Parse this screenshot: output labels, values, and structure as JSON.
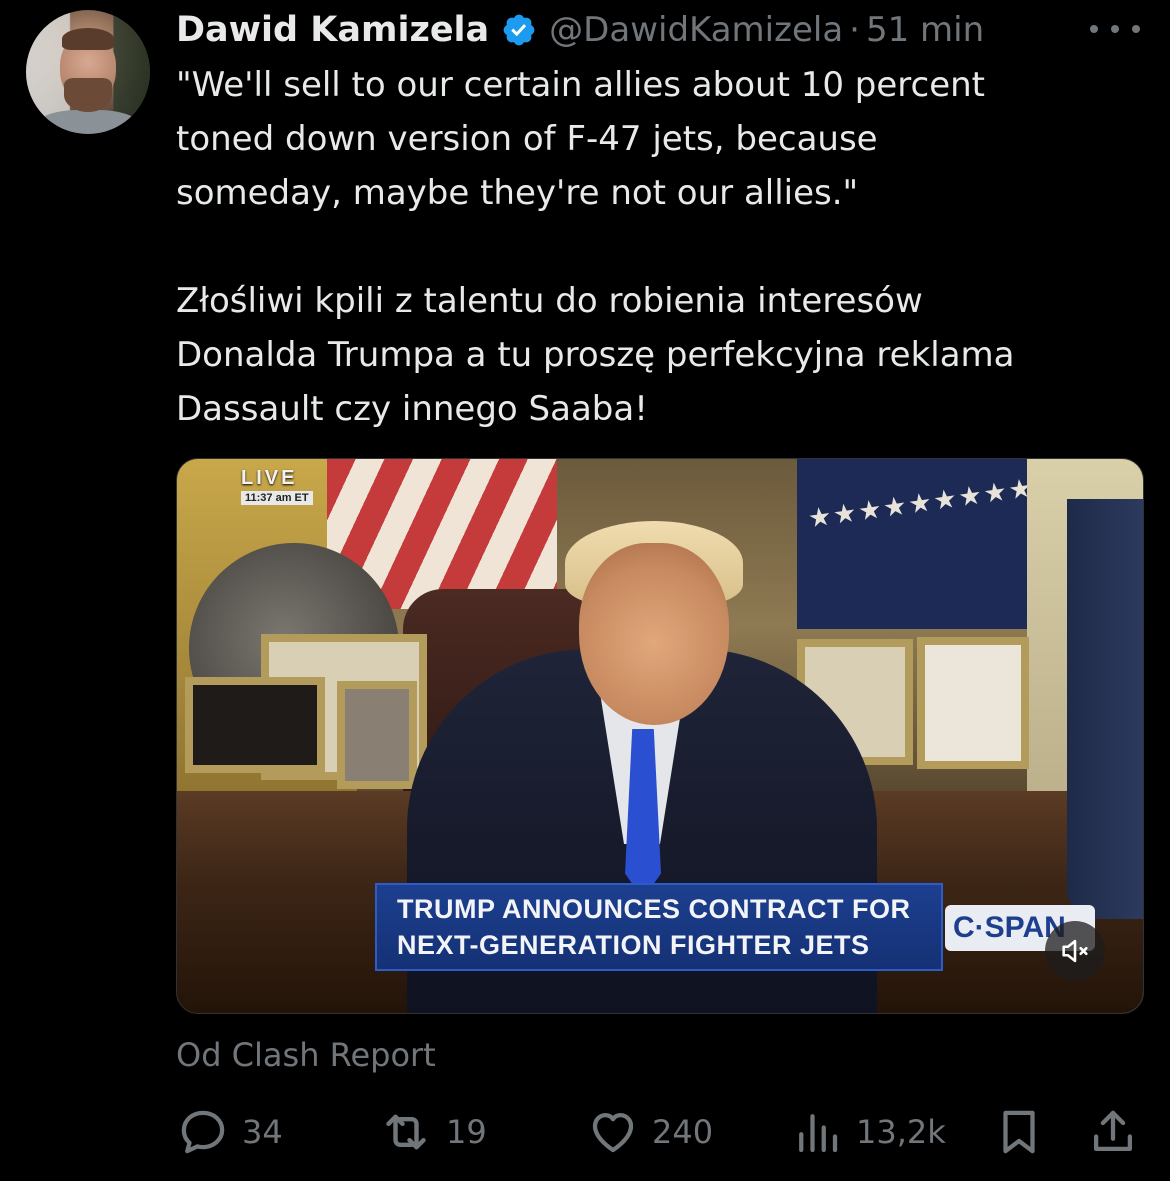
{
  "author": {
    "name": "Dawid Kamizela",
    "handle": "@DawidKamizela",
    "separator": "·",
    "time": "51 min"
  },
  "tweet": {
    "paragraph1": [
      "\"We'll sell to our certain allies about 10 percent",
      "toned down version of F-47 jets, because",
      "someday, maybe they're not our allies.\""
    ],
    "paragraph2": [
      "Złośliwi kpili z talentu do robienia interesów",
      "Donalda Trumpa a tu proszę perfekcyjna reklama",
      "Dassault czy innego Saaba!"
    ]
  },
  "media": {
    "live_label": "LIVE",
    "live_time": "11:37 am ET",
    "chyron_line1": "TRUMP ANNOUNCES CONTRACT FOR",
    "chyron_line2": "NEXT-GENERATION FIGHTER JETS",
    "network_logo": "C·SPAN",
    "stars": "★★★★★★★★★★"
  },
  "source": "Od Clash Report",
  "actions": {
    "replies": "34",
    "reposts": "19",
    "likes": "240",
    "views": "13,2k"
  },
  "colors": {
    "background": "#000000",
    "text": "#e7e9ea",
    "muted": "#71767b",
    "verified": "#1d9bf0"
  }
}
